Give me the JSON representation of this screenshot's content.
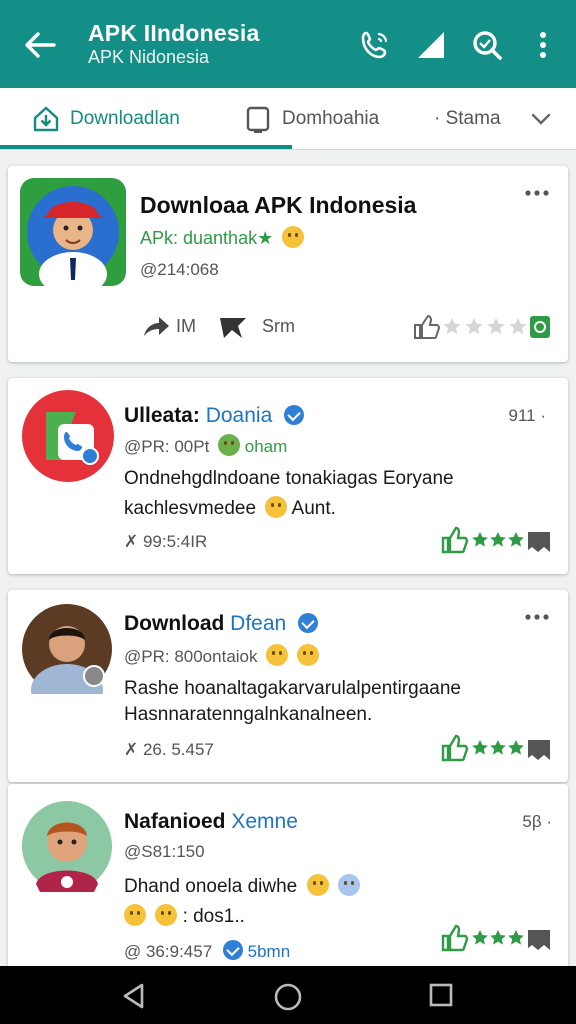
{
  "appbar": {
    "title": "APK IIndonesia",
    "subtitle": "APK Nidonesia",
    "accent": "#138f87",
    "icons": [
      "back-arrow-icon",
      "phone-icon",
      "signal-icon",
      "search-icon",
      "more-vert-icon"
    ]
  },
  "tabs": [
    {
      "label": "Downloadlan",
      "icon": "home-download-icon",
      "active": true
    },
    {
      "label": "Domhoahia",
      "icon": "tablet-icon",
      "active": false
    },
    {
      "label": "· Stama",
      "icon": "chevron-down-icon",
      "active": false
    }
  ],
  "cards": [
    {
      "title": "Downloaa APK Indonesia",
      "subtitle": "APk: duanthak★",
      "meta": "@214:068",
      "share": "IM",
      "tag": "Srm",
      "star_rating": 0
    },
    {
      "title": "Ulleata:",
      "title_accent": "Doania",
      "right": "911 ·",
      "line1_prefix": "@PR: 00Pt",
      "line1_accent": "oham",
      "body1": "Ondnehgdlndoane tonakiagas Eoryane",
      "body2": "kachlesvmedee",
      "body2_tail": "Aunt.",
      "meta": "✗ 99:5:4IR"
    },
    {
      "title": "Download",
      "title_accent": "Dfean",
      "line1_prefix": "@PR: 800ontaiok",
      "body1": "Rashe hoanaltagakarvarulalpentirgaane",
      "body2": "Hasnnaratenngalnkanalneen.",
      "meta": "✗ 26. 5.457"
    },
    {
      "title": "Nafanioed",
      "title_accent": "Xemne",
      "right": "5β ·",
      "line1_prefix": "@S81:150",
      "body1": "Dhand onoela diwhe",
      "body2": ": dos1..",
      "meta": "@ 36:9:457",
      "meta_accent": "5bmn"
    }
  ],
  "colors": {
    "green": "#2f9b44",
    "blue": "#1d73c9",
    "navbar": "#000000"
  }
}
